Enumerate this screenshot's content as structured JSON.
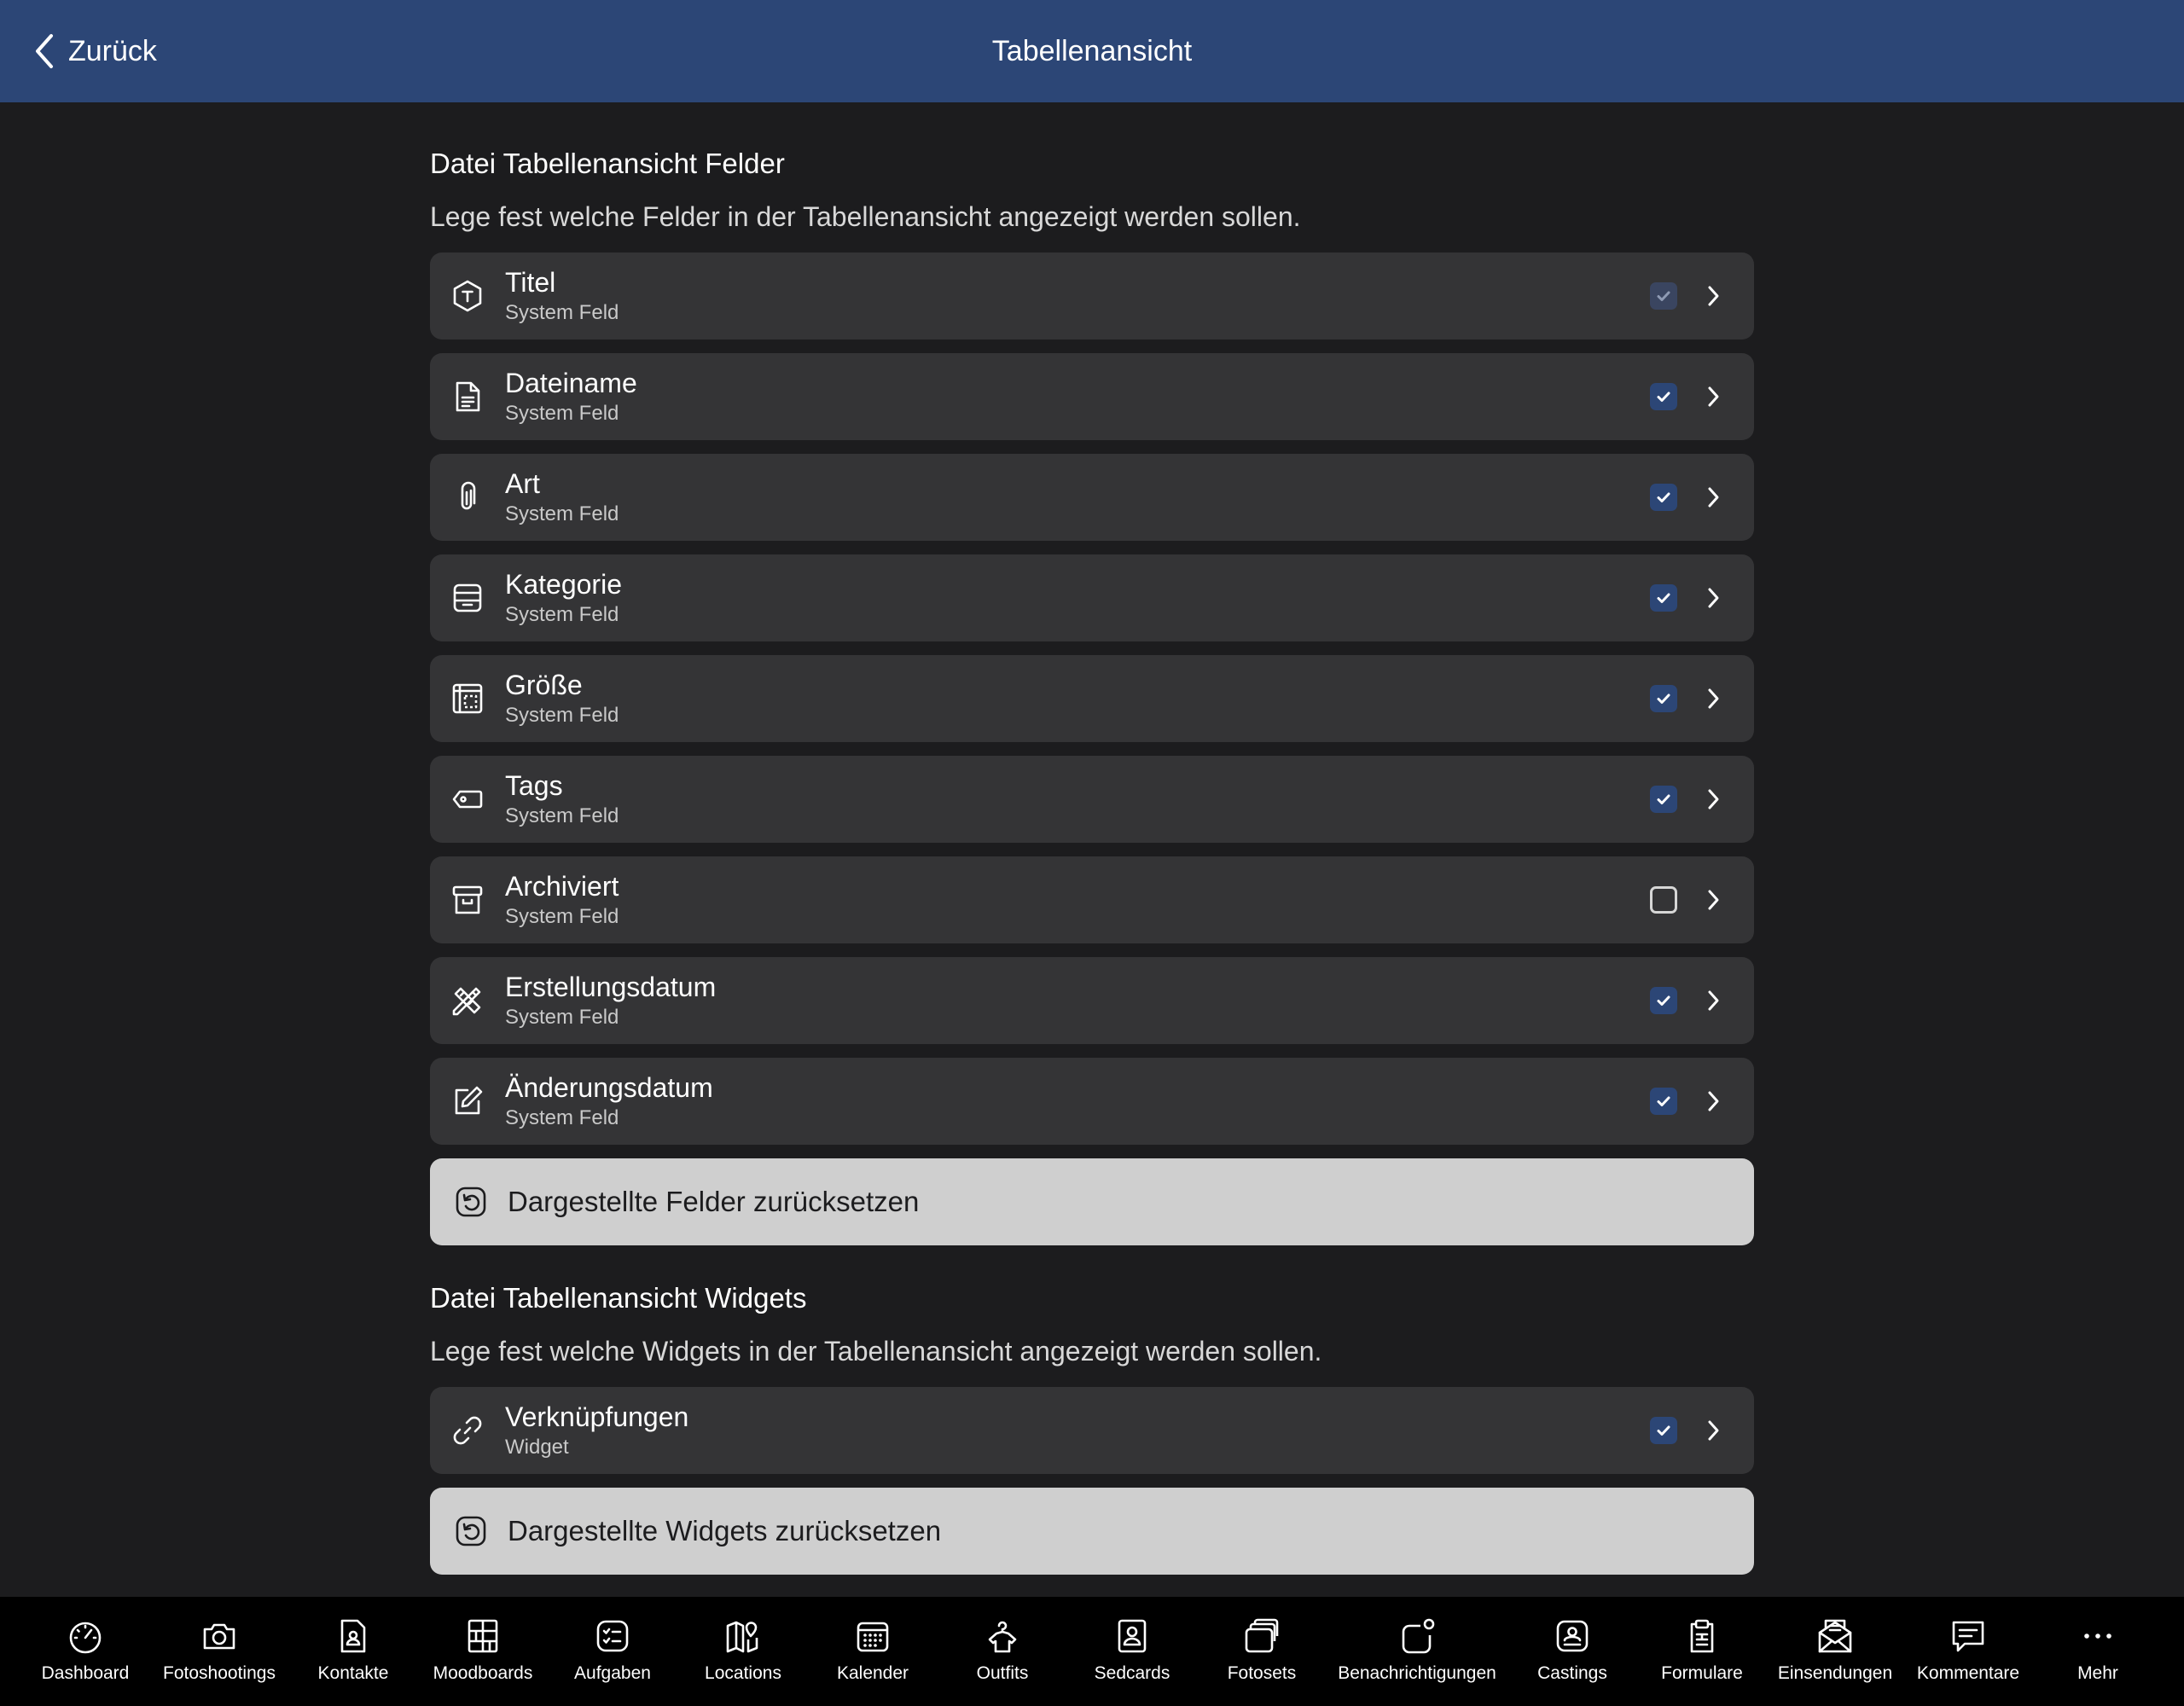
{
  "header": {
    "back_label": "Zurück",
    "title": "Tabellenansicht"
  },
  "fields_section": {
    "title": "Datei Tabellenansicht Felder",
    "description": "Lege fest welche Felder in der Tabellenansicht angezeigt werden sollen.",
    "items": [
      {
        "title": "Titel",
        "subtitle": "System Feld",
        "icon": "hexagon-t-icon",
        "checked": true,
        "disabled": true
      },
      {
        "title": "Dateiname",
        "subtitle": "System Feld",
        "icon": "document-icon",
        "checked": true
      },
      {
        "title": "Art",
        "subtitle": "System Feld",
        "icon": "paperclip-icon",
        "checked": true
      },
      {
        "title": "Kategorie",
        "subtitle": "System Feld",
        "icon": "tray-icon",
        "checked": true
      },
      {
        "title": "Größe",
        "subtitle": "System Feld",
        "icon": "dimensions-icon",
        "checked": true
      },
      {
        "title": "Tags",
        "subtitle": "System Feld",
        "icon": "tag-icon",
        "checked": true
      },
      {
        "title": "Archiviert",
        "subtitle": "System Feld",
        "icon": "archive-icon",
        "checked": false
      },
      {
        "title": "Erstellungsdatum",
        "subtitle": "System Feld",
        "icon": "pencil-ruler-icon",
        "checked": true
      },
      {
        "title": "Änderungsdatum",
        "subtitle": "System Feld",
        "icon": "edit-icon",
        "checked": true
      }
    ],
    "reset_label": "Dargestellte Felder zurücksetzen"
  },
  "widgets_section": {
    "title": "Datei Tabellenansicht Widgets",
    "description": "Lege fest welche Widgets in der Tabellenansicht angezeigt werden sollen.",
    "items": [
      {
        "title": "Verknüpfungen",
        "subtitle": "Widget",
        "icon": "link-icon",
        "checked": true
      }
    ],
    "reset_label": "Dargestellte Widgets zurücksetzen"
  },
  "tabbar": {
    "items": [
      {
        "label": "Dashboard",
        "icon": "speedometer-icon"
      },
      {
        "label": "Fotoshootings",
        "icon": "camera-icon"
      },
      {
        "label": "Kontakte",
        "icon": "contact-icon"
      },
      {
        "label": "Moodboards",
        "icon": "moodboard-icon"
      },
      {
        "label": "Aufgaben",
        "icon": "tasks-icon"
      },
      {
        "label": "Locations",
        "icon": "map-pin-icon"
      },
      {
        "label": "Kalender",
        "icon": "calendar-icon"
      },
      {
        "label": "Outfits",
        "icon": "hanger-icon"
      },
      {
        "label": "Sedcards",
        "icon": "sedcard-icon"
      },
      {
        "label": "Fotosets",
        "icon": "photosets-icon"
      },
      {
        "label": "Benachrichtigungen",
        "icon": "notification-icon"
      },
      {
        "label": "Castings",
        "icon": "casting-icon"
      },
      {
        "label": "Formulare",
        "icon": "clipboard-icon"
      },
      {
        "label": "Einsendungen",
        "icon": "envelope-icon"
      },
      {
        "label": "Kommentare",
        "icon": "comment-icon"
      },
      {
        "label": "Mehr",
        "icon": "more-icon"
      }
    ]
  },
  "colors": {
    "header_bg": "#2c4676",
    "background": "#1c1c1e",
    "row_bg": "#343436",
    "accent": "#2c4676",
    "reset_bg": "#cfcfcf",
    "tabbar_bg": "#000000"
  }
}
